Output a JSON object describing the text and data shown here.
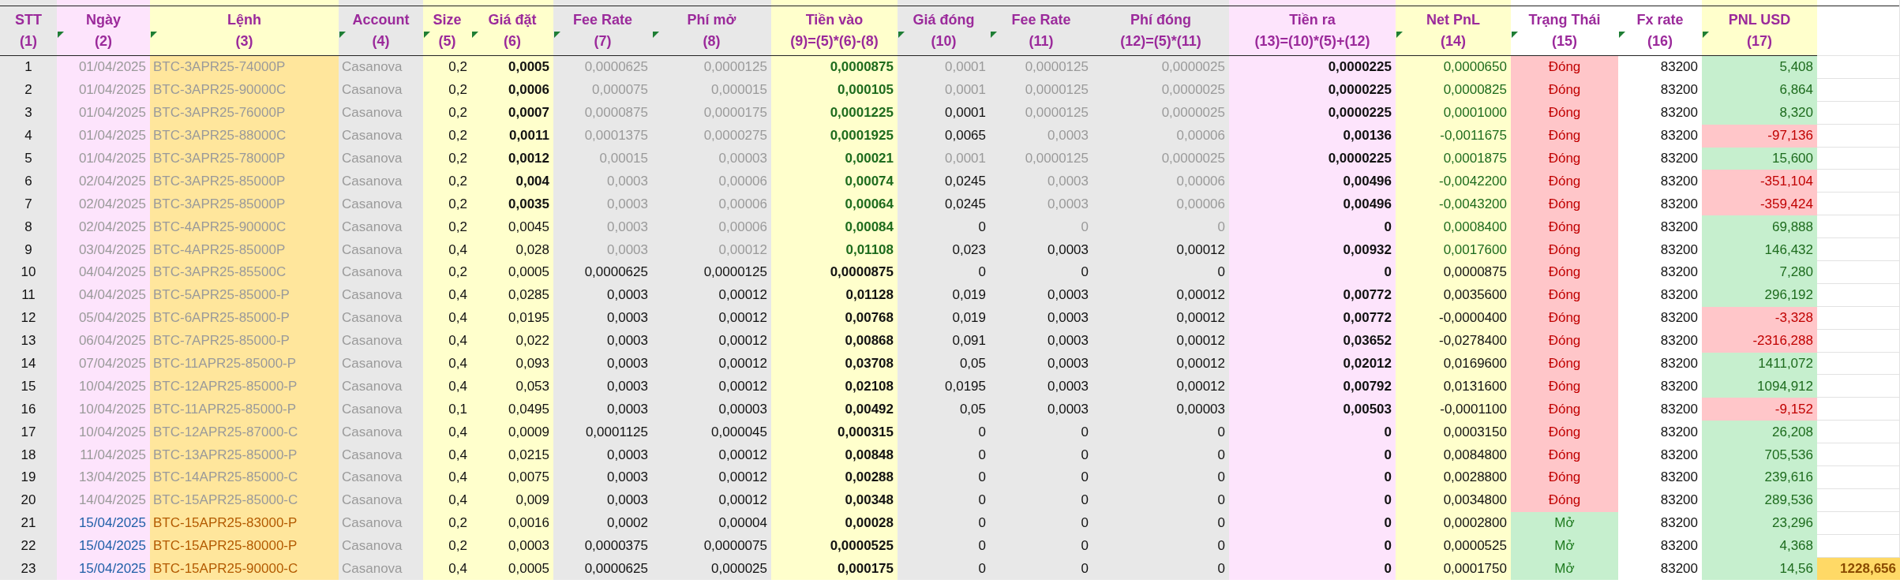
{
  "table": {
    "columns": [
      {
        "label": "STT",
        "number": "(1)",
        "note": false
      },
      {
        "label": "Ngày",
        "number": "(2)",
        "note": true
      },
      {
        "label": "Lệnh",
        "number": "(3)",
        "note": true
      },
      {
        "label": "Account",
        "number": "(4)",
        "note": true
      },
      {
        "label": "Size",
        "number": "(5)",
        "note": true
      },
      {
        "label": "Giá đặt",
        "number": "(6)",
        "note": true
      },
      {
        "label": "Fee Rate",
        "number": "(7)",
        "note": true
      },
      {
        "label": "Phí mở",
        "number": "(8)",
        "note": true
      },
      {
        "label": "Tiền vào",
        "number": "(9)=(5)*(6)-(8)",
        "note": false
      },
      {
        "label": "Giá đóng",
        "number": "(10)",
        "note": true
      },
      {
        "label": "Fee Rate",
        "number": "(11)",
        "note": true
      },
      {
        "label": "Phí đóng",
        "number": "(12)=(5)*(11)",
        "note": false
      },
      {
        "label": "Tiền ra",
        "number": "(13)=(10)*(5)+(12)",
        "note": false
      },
      {
        "label": "Net PnL",
        "number": "(14)",
        "note": true
      },
      {
        "label": "Trạng Thái",
        "number": "(15)",
        "note": true
      },
      {
        "label": "Fx rate",
        "number": "(16)",
        "note": true
      },
      {
        "label": "PNL USD",
        "number": "(17)",
        "note": true
      }
    ],
    "rows": [
      {
        "cells": [
          {
            "text": "1",
            "kind": "plain"
          },
          {
            "text": "01/04/2025",
            "kind": "muted"
          },
          {
            "text": "BTC-3APR25-74000P",
            "kind": "muted"
          },
          {
            "text": "Casanova",
            "kind": "muted"
          },
          {
            "text": "0,2",
            "kind": "plain"
          },
          {
            "text": "0,0005",
            "kind": "bold"
          },
          {
            "text": "0,0000625",
            "kind": "muted"
          },
          {
            "text": "0,0000125",
            "kind": "muted"
          },
          {
            "text": "0,0000875",
            "kind": "greenbold"
          },
          {
            "text": "0,0001",
            "kind": "muted"
          },
          {
            "text": "0,0000125",
            "kind": "muted"
          },
          {
            "text": "0,0000025",
            "kind": "muted"
          },
          {
            "text": "0,0000225",
            "kind": "bold"
          },
          {
            "text": "0,0000650",
            "kind": "green"
          },
          {
            "text": "Đóng",
            "kind": "closed"
          },
          {
            "text": "83200",
            "kind": "plain"
          },
          {
            "text": "5,408",
            "kind": "gain"
          }
        ]
      },
      {
        "cells": [
          {
            "text": "2",
            "kind": "plain"
          },
          {
            "text": "01/04/2025",
            "kind": "muted"
          },
          {
            "text": "BTC-3APR25-90000C",
            "kind": "muted"
          },
          {
            "text": "Casanova",
            "kind": "muted"
          },
          {
            "text": "0,2",
            "kind": "plain"
          },
          {
            "text": "0,0006",
            "kind": "bold"
          },
          {
            "text": "0,000075",
            "kind": "muted"
          },
          {
            "text": "0,000015",
            "kind": "muted"
          },
          {
            "text": "0,000105",
            "kind": "greenbold"
          },
          {
            "text": "0,0001",
            "kind": "muted"
          },
          {
            "text": "0,0000125",
            "kind": "muted"
          },
          {
            "text": "0,0000025",
            "kind": "muted"
          },
          {
            "text": "0,0000225",
            "kind": "bold"
          },
          {
            "text": "0,0000825",
            "kind": "green"
          },
          {
            "text": "Đóng",
            "kind": "closed"
          },
          {
            "text": "83200",
            "kind": "plain"
          },
          {
            "text": "6,864",
            "kind": "gain"
          }
        ]
      },
      {
        "cells": [
          {
            "text": "3",
            "kind": "plain"
          },
          {
            "text": "01/04/2025",
            "kind": "muted"
          },
          {
            "text": "BTC-3APR25-76000P",
            "kind": "muted"
          },
          {
            "text": "Casanova",
            "kind": "muted"
          },
          {
            "text": "0,2",
            "kind": "plain"
          },
          {
            "text": "0,0007",
            "kind": "bold"
          },
          {
            "text": "0,0000875",
            "kind": "muted"
          },
          {
            "text": "0,0000175",
            "kind": "muted"
          },
          {
            "text": "0,0001225",
            "kind": "greenbold"
          },
          {
            "text": "0,0001",
            "kind": "plain"
          },
          {
            "text": "0,0000125",
            "kind": "muted"
          },
          {
            "text": "0,0000025",
            "kind": "muted"
          },
          {
            "text": "0,0000225",
            "kind": "bold"
          },
          {
            "text": "0,0001000",
            "kind": "green"
          },
          {
            "text": "Đóng",
            "kind": "closed"
          },
          {
            "text": "83200",
            "kind": "plain"
          },
          {
            "text": "8,320",
            "kind": "gain"
          }
        ]
      },
      {
        "cells": [
          {
            "text": "4",
            "kind": "plain"
          },
          {
            "text": "01/04/2025",
            "kind": "muted"
          },
          {
            "text": "BTC-3APR25-88000C",
            "kind": "muted"
          },
          {
            "text": "Casanova",
            "kind": "muted"
          },
          {
            "text": "0,2",
            "kind": "plain"
          },
          {
            "text": "0,0011",
            "kind": "bold"
          },
          {
            "text": "0,0001375",
            "kind": "muted"
          },
          {
            "text": "0,0000275",
            "kind": "muted"
          },
          {
            "text": "0,0001925",
            "kind": "greenbold"
          },
          {
            "text": "0,0065",
            "kind": "plain"
          },
          {
            "text": "0,0003",
            "kind": "muted"
          },
          {
            "text": "0,00006",
            "kind": "muted"
          },
          {
            "text": "0,00136",
            "kind": "bold"
          },
          {
            "text": "-0,0011675",
            "kind": "green"
          },
          {
            "text": "Đóng",
            "kind": "closed"
          },
          {
            "text": "83200",
            "kind": "plain"
          },
          {
            "text": "-97,136",
            "kind": "loss"
          }
        ]
      },
      {
        "cells": [
          {
            "text": "5",
            "kind": "plain"
          },
          {
            "text": "01/04/2025",
            "kind": "muted"
          },
          {
            "text": "BTC-3APR25-78000P",
            "kind": "muted"
          },
          {
            "text": "Casanova",
            "kind": "muted"
          },
          {
            "text": "0,2",
            "kind": "plain"
          },
          {
            "text": "0,0012",
            "kind": "bold"
          },
          {
            "text": "0,00015",
            "kind": "muted"
          },
          {
            "text": "0,00003",
            "kind": "muted"
          },
          {
            "text": "0,00021",
            "kind": "greenbold"
          },
          {
            "text": "0,0001",
            "kind": "muted"
          },
          {
            "text": "0,0000125",
            "kind": "muted"
          },
          {
            "text": "0,0000025",
            "kind": "muted"
          },
          {
            "text": "0,0000225",
            "kind": "bold"
          },
          {
            "text": "0,0001875",
            "kind": "green"
          },
          {
            "text": "Đóng",
            "kind": "closed"
          },
          {
            "text": "83200",
            "kind": "plain"
          },
          {
            "text": "15,600",
            "kind": "gain"
          }
        ]
      },
      {
        "cells": [
          {
            "text": "6",
            "kind": "plain"
          },
          {
            "text": "02/04/2025",
            "kind": "muted"
          },
          {
            "text": "BTC-3APR25-85000P",
            "kind": "muted"
          },
          {
            "text": "Casanova",
            "kind": "muted"
          },
          {
            "text": "0,2",
            "kind": "plain"
          },
          {
            "text": "0,004",
            "kind": "bold"
          },
          {
            "text": "0,0003",
            "kind": "muted"
          },
          {
            "text": "0,00006",
            "kind": "muted"
          },
          {
            "text": "0,00074",
            "kind": "greenbold"
          },
          {
            "text": "0,0245",
            "kind": "plain"
          },
          {
            "text": "0,0003",
            "kind": "muted"
          },
          {
            "text": "0,00006",
            "kind": "muted"
          },
          {
            "text": "0,00496",
            "kind": "bold"
          },
          {
            "text": "-0,0042200",
            "kind": "green"
          },
          {
            "text": "Đóng",
            "kind": "closed"
          },
          {
            "text": "83200",
            "kind": "plain"
          },
          {
            "text": "-351,104",
            "kind": "loss"
          }
        ]
      },
      {
        "cells": [
          {
            "text": "7",
            "kind": "plain"
          },
          {
            "text": "02/04/2025",
            "kind": "muted"
          },
          {
            "text": "BTC-3APR25-85000P",
            "kind": "muted"
          },
          {
            "text": "Casanova",
            "kind": "muted"
          },
          {
            "text": "0,2",
            "kind": "plain"
          },
          {
            "text": "0,0035",
            "kind": "bold"
          },
          {
            "text": "0,0003",
            "kind": "muted"
          },
          {
            "text": "0,00006",
            "kind": "muted"
          },
          {
            "text": "0,00064",
            "kind": "greenbold"
          },
          {
            "text": "0,0245",
            "kind": "plain"
          },
          {
            "text": "0,0003",
            "kind": "muted"
          },
          {
            "text": "0,00006",
            "kind": "muted"
          },
          {
            "text": "0,00496",
            "kind": "bold"
          },
          {
            "text": "-0,0043200",
            "kind": "green"
          },
          {
            "text": "Đóng",
            "kind": "closed"
          },
          {
            "text": "83200",
            "kind": "plain"
          },
          {
            "text": "-359,424",
            "kind": "loss"
          }
        ]
      },
      {
        "cells": [
          {
            "text": "8",
            "kind": "plain"
          },
          {
            "text": "02/04/2025",
            "kind": "muted"
          },
          {
            "text": "BTC-4APR25-90000C",
            "kind": "muted"
          },
          {
            "text": "Casanova",
            "kind": "muted"
          },
          {
            "text": "0,2",
            "kind": "plain"
          },
          {
            "text": "0,0045",
            "kind": "plain"
          },
          {
            "text": "0,0003",
            "kind": "muted"
          },
          {
            "text": "0,00006",
            "kind": "muted"
          },
          {
            "text": "0,00084",
            "kind": "greenbold"
          },
          {
            "text": "0",
            "kind": "plain"
          },
          {
            "text": "0",
            "kind": "muted"
          },
          {
            "text": "0",
            "kind": "muted"
          },
          {
            "text": "0",
            "kind": "bold"
          },
          {
            "text": "0,0008400",
            "kind": "green"
          },
          {
            "text": "Đóng",
            "kind": "closed"
          },
          {
            "text": "83200",
            "kind": "plain"
          },
          {
            "text": "69,888",
            "kind": "gain"
          }
        ]
      },
      {
        "cells": [
          {
            "text": "9",
            "kind": "plain"
          },
          {
            "text": "03/04/2025",
            "kind": "muted"
          },
          {
            "text": "BTC-4APR25-85000P",
            "kind": "muted"
          },
          {
            "text": "Casanova",
            "kind": "muted"
          },
          {
            "text": "0,4",
            "kind": "plain"
          },
          {
            "text": "0,028",
            "kind": "plain"
          },
          {
            "text": "0,0003",
            "kind": "muted"
          },
          {
            "text": "0,00012",
            "kind": "muted"
          },
          {
            "text": "0,01108",
            "kind": "greenbold"
          },
          {
            "text": "0,023",
            "kind": "plain"
          },
          {
            "text": "0,0003",
            "kind": "plain"
          },
          {
            "text": "0,00012",
            "kind": "plain"
          },
          {
            "text": "0,00932",
            "kind": "bold"
          },
          {
            "text": "0,0017600",
            "kind": "green"
          },
          {
            "text": "Đóng",
            "kind": "closed"
          },
          {
            "text": "83200",
            "kind": "plain"
          },
          {
            "text": "146,432",
            "kind": "gain"
          }
        ]
      },
      {
        "cells": [
          {
            "text": "10",
            "kind": "plain"
          },
          {
            "text": "04/04/2025",
            "kind": "muted"
          },
          {
            "text": "BTC-3APR25-85500C",
            "kind": "muted"
          },
          {
            "text": "Casanova",
            "kind": "muted"
          },
          {
            "text": "0,2",
            "kind": "plain"
          },
          {
            "text": "0,0005",
            "kind": "plain"
          },
          {
            "text": "0,0000625",
            "kind": "plain"
          },
          {
            "text": "0,0000125",
            "kind": "plain"
          },
          {
            "text": "0,0000875",
            "kind": "bold"
          },
          {
            "text": "0",
            "kind": "plain"
          },
          {
            "text": "0",
            "kind": "plain"
          },
          {
            "text": "0",
            "kind": "plain"
          },
          {
            "text": "0",
            "kind": "bold"
          },
          {
            "text": "0,0000875",
            "kind": "plain"
          },
          {
            "text": "Đóng",
            "kind": "closed"
          },
          {
            "text": "83200",
            "kind": "plain"
          },
          {
            "text": "7,280",
            "kind": "gain"
          }
        ]
      },
      {
        "cells": [
          {
            "text": "11",
            "kind": "plain"
          },
          {
            "text": "04/04/2025",
            "kind": "muted"
          },
          {
            "text": "BTC-5APR25-85000-P",
            "kind": "muted"
          },
          {
            "text": "Casanova",
            "kind": "muted"
          },
          {
            "text": "0,4",
            "kind": "plain"
          },
          {
            "text": "0,0285",
            "kind": "plain"
          },
          {
            "text": "0,0003",
            "kind": "plain"
          },
          {
            "text": "0,00012",
            "kind": "plain"
          },
          {
            "text": "0,01128",
            "kind": "bold"
          },
          {
            "text": "0,019",
            "kind": "plain"
          },
          {
            "text": "0,0003",
            "kind": "plain"
          },
          {
            "text": "0,00012",
            "kind": "plain"
          },
          {
            "text": "0,00772",
            "kind": "bold"
          },
          {
            "text": "0,0035600",
            "kind": "plain"
          },
          {
            "text": "Đóng",
            "kind": "closed"
          },
          {
            "text": "83200",
            "kind": "plain"
          },
          {
            "text": "296,192",
            "kind": "gain"
          }
        ]
      },
      {
        "cells": [
          {
            "text": "12",
            "kind": "plain"
          },
          {
            "text": "05/04/2025",
            "kind": "muted"
          },
          {
            "text": "BTC-6APR25-85000-P",
            "kind": "muted"
          },
          {
            "text": "Casanova",
            "kind": "muted"
          },
          {
            "text": "0,4",
            "kind": "plain"
          },
          {
            "text": "0,0195",
            "kind": "plain"
          },
          {
            "text": "0,0003",
            "kind": "plain"
          },
          {
            "text": "0,00012",
            "kind": "plain"
          },
          {
            "text": "0,00768",
            "kind": "bold"
          },
          {
            "text": "0,019",
            "kind": "plain"
          },
          {
            "text": "0,0003",
            "kind": "plain"
          },
          {
            "text": "0,00012",
            "kind": "plain"
          },
          {
            "text": "0,00772",
            "kind": "bold"
          },
          {
            "text": "-0,0000400",
            "kind": "plain"
          },
          {
            "text": "Đóng",
            "kind": "closed"
          },
          {
            "text": "83200",
            "kind": "plain"
          },
          {
            "text": "-3,328",
            "kind": "loss"
          }
        ]
      },
      {
        "cells": [
          {
            "text": "13",
            "kind": "plain"
          },
          {
            "text": "06/04/2025",
            "kind": "muted"
          },
          {
            "text": "BTC-7APR25-85000-P",
            "kind": "muted"
          },
          {
            "text": "Casanova",
            "kind": "muted"
          },
          {
            "text": "0,4",
            "kind": "plain"
          },
          {
            "text": "0,022",
            "kind": "plain"
          },
          {
            "text": "0,0003",
            "kind": "plain"
          },
          {
            "text": "0,00012",
            "kind": "plain"
          },
          {
            "text": "0,00868",
            "kind": "bold"
          },
          {
            "text": "0,091",
            "kind": "plain"
          },
          {
            "text": "0,0003",
            "kind": "plain"
          },
          {
            "text": "0,00012",
            "kind": "plain"
          },
          {
            "text": "0,03652",
            "kind": "bold"
          },
          {
            "text": "-0,0278400",
            "kind": "plain"
          },
          {
            "text": "Đóng",
            "kind": "closed"
          },
          {
            "text": "83200",
            "kind": "plain"
          },
          {
            "text": "-2316,288",
            "kind": "loss"
          }
        ]
      },
      {
        "cells": [
          {
            "text": "14",
            "kind": "plain"
          },
          {
            "text": "07/04/2025",
            "kind": "muted"
          },
          {
            "text": "BTC-11APR25-85000-P",
            "kind": "muted"
          },
          {
            "text": "Casanova",
            "kind": "muted"
          },
          {
            "text": "0,4",
            "kind": "plain"
          },
          {
            "text": "0,093",
            "kind": "plain"
          },
          {
            "text": "0,0003",
            "kind": "plain"
          },
          {
            "text": "0,00012",
            "kind": "plain"
          },
          {
            "text": "0,03708",
            "kind": "bold"
          },
          {
            "text": "0,05",
            "kind": "plain"
          },
          {
            "text": "0,0003",
            "kind": "plain"
          },
          {
            "text": "0,00012",
            "kind": "plain"
          },
          {
            "text": "0,02012",
            "kind": "bold"
          },
          {
            "text": "0,0169600",
            "kind": "plain"
          },
          {
            "text": "Đóng",
            "kind": "closed"
          },
          {
            "text": "83200",
            "kind": "plain"
          },
          {
            "text": "1411,072",
            "kind": "gain"
          }
        ]
      },
      {
        "cells": [
          {
            "text": "15",
            "kind": "plain"
          },
          {
            "text": "10/04/2025",
            "kind": "muted"
          },
          {
            "text": "BTC-12APR25-85000-P",
            "kind": "muted"
          },
          {
            "text": "Casanova",
            "kind": "muted"
          },
          {
            "text": "0,4",
            "kind": "plain"
          },
          {
            "text": "0,053",
            "kind": "plain"
          },
          {
            "text": "0,0003",
            "kind": "plain"
          },
          {
            "text": "0,00012",
            "kind": "plain"
          },
          {
            "text": "0,02108",
            "kind": "bold"
          },
          {
            "text": "0,0195",
            "kind": "plain"
          },
          {
            "text": "0,0003",
            "kind": "plain"
          },
          {
            "text": "0,00012",
            "kind": "plain"
          },
          {
            "text": "0,00792",
            "kind": "bold"
          },
          {
            "text": "0,0131600",
            "kind": "plain"
          },
          {
            "text": "Đóng",
            "kind": "closed"
          },
          {
            "text": "83200",
            "kind": "plain"
          },
          {
            "text": "1094,912",
            "kind": "gain"
          }
        ]
      },
      {
        "cells": [
          {
            "text": "16",
            "kind": "plain"
          },
          {
            "text": "10/04/2025",
            "kind": "muted"
          },
          {
            "text": "BTC-11APR25-85000-P",
            "kind": "muted"
          },
          {
            "text": "Casanova",
            "kind": "muted"
          },
          {
            "text": "0,1",
            "kind": "plain"
          },
          {
            "text": "0,0495",
            "kind": "plain"
          },
          {
            "text": "0,0003",
            "kind": "plain"
          },
          {
            "text": "0,00003",
            "kind": "plain"
          },
          {
            "text": "0,00492",
            "kind": "bold"
          },
          {
            "text": "0,05",
            "kind": "plain"
          },
          {
            "text": "0,0003",
            "kind": "plain"
          },
          {
            "text": "0,00003",
            "kind": "plain"
          },
          {
            "text": "0,00503",
            "kind": "bold"
          },
          {
            "text": "-0,0001100",
            "kind": "plain"
          },
          {
            "text": "Đóng",
            "kind": "closed"
          },
          {
            "text": "83200",
            "kind": "plain"
          },
          {
            "text": "-9,152",
            "kind": "loss"
          }
        ]
      },
      {
        "cells": [
          {
            "text": "17",
            "kind": "plain"
          },
          {
            "text": "10/04/2025",
            "kind": "muted"
          },
          {
            "text": "BTC-12APR25-87000-C",
            "kind": "muted"
          },
          {
            "text": "Casanova",
            "kind": "muted"
          },
          {
            "text": "0,4",
            "kind": "plain"
          },
          {
            "text": "0,0009",
            "kind": "plain"
          },
          {
            "text": "0,0001125",
            "kind": "plain"
          },
          {
            "text": "0,000045",
            "kind": "plain"
          },
          {
            "text": "0,000315",
            "kind": "bold"
          },
          {
            "text": "0",
            "kind": "plain"
          },
          {
            "text": "0",
            "kind": "plain"
          },
          {
            "text": "0",
            "kind": "plain"
          },
          {
            "text": "0",
            "kind": "bold"
          },
          {
            "text": "0,0003150",
            "kind": "plain"
          },
          {
            "text": "Đóng",
            "kind": "closed"
          },
          {
            "text": "83200",
            "kind": "plain"
          },
          {
            "text": "26,208",
            "kind": "gain"
          }
        ]
      },
      {
        "cells": [
          {
            "text": "18",
            "kind": "plain"
          },
          {
            "text": "11/04/2025",
            "kind": "muted"
          },
          {
            "text": "BTC-13APR25-85000-P",
            "kind": "muted"
          },
          {
            "text": "Casanova",
            "kind": "muted"
          },
          {
            "text": "0,4",
            "kind": "plain"
          },
          {
            "text": "0,0215",
            "kind": "plain"
          },
          {
            "text": "0,0003",
            "kind": "plain"
          },
          {
            "text": "0,00012",
            "kind": "plain"
          },
          {
            "text": "0,00848",
            "kind": "bold"
          },
          {
            "text": "0",
            "kind": "plain"
          },
          {
            "text": "0",
            "kind": "plain"
          },
          {
            "text": "0",
            "kind": "plain"
          },
          {
            "text": "0",
            "kind": "bold"
          },
          {
            "text": "0,0084800",
            "kind": "plain"
          },
          {
            "text": "Đóng",
            "kind": "closed"
          },
          {
            "text": "83200",
            "kind": "plain"
          },
          {
            "text": "705,536",
            "kind": "gain"
          }
        ]
      },
      {
        "cells": [
          {
            "text": "19",
            "kind": "plain"
          },
          {
            "text": "13/04/2025",
            "kind": "muted"
          },
          {
            "text": "BTC-14APR25-85000-C",
            "kind": "muted"
          },
          {
            "text": "Casanova",
            "kind": "muted"
          },
          {
            "text": "0,4",
            "kind": "plain"
          },
          {
            "text": "0,0075",
            "kind": "plain"
          },
          {
            "text": "0,0003",
            "kind": "plain"
          },
          {
            "text": "0,00012",
            "kind": "plain"
          },
          {
            "text": "0,00288",
            "kind": "bold"
          },
          {
            "text": "0",
            "kind": "plain"
          },
          {
            "text": "0",
            "kind": "plain"
          },
          {
            "text": "0",
            "kind": "plain"
          },
          {
            "text": "0",
            "kind": "bold"
          },
          {
            "text": "0,0028800",
            "kind": "plain"
          },
          {
            "text": "Đóng",
            "kind": "closed"
          },
          {
            "text": "83200",
            "kind": "plain"
          },
          {
            "text": "239,616",
            "kind": "gain"
          }
        ]
      },
      {
        "cells": [
          {
            "text": "20",
            "kind": "plain"
          },
          {
            "text": "14/04/2025",
            "kind": "muted"
          },
          {
            "text": "BTC-15APR25-85000-C",
            "kind": "muted"
          },
          {
            "text": "Casanova",
            "kind": "muted"
          },
          {
            "text": "0,4",
            "kind": "plain"
          },
          {
            "text": "0,009",
            "kind": "plain"
          },
          {
            "text": "0,0003",
            "kind": "plain"
          },
          {
            "text": "0,00012",
            "kind": "plain"
          },
          {
            "text": "0,00348",
            "kind": "bold"
          },
          {
            "text": "0",
            "kind": "plain"
          },
          {
            "text": "0",
            "kind": "plain"
          },
          {
            "text": "0",
            "kind": "plain"
          },
          {
            "text": "0",
            "kind": "bold"
          },
          {
            "text": "0,0034800",
            "kind": "plain"
          },
          {
            "text": "Đóng",
            "kind": "closed"
          },
          {
            "text": "83200",
            "kind": "plain"
          },
          {
            "text": "289,536",
            "kind": "gain"
          }
        ]
      },
      {
        "cells": [
          {
            "text": "21",
            "kind": "plain"
          },
          {
            "text": "15/04/2025",
            "kind": "blue"
          },
          {
            "text": "BTC-15APR25-83000-P",
            "kind": "brown"
          },
          {
            "text": "Casanova",
            "kind": "muted"
          },
          {
            "text": "0,2",
            "kind": "plain"
          },
          {
            "text": "0,0016",
            "kind": "plain"
          },
          {
            "text": "0,0002",
            "kind": "plain"
          },
          {
            "text": "0,00004",
            "kind": "plain"
          },
          {
            "text": "0,00028",
            "kind": "bold"
          },
          {
            "text": "0",
            "kind": "plain"
          },
          {
            "text": "0",
            "kind": "plain"
          },
          {
            "text": "0",
            "kind": "plain"
          },
          {
            "text": "0",
            "kind": "bold"
          },
          {
            "text": "0,0002800",
            "kind": "plain"
          },
          {
            "text": "Mở",
            "kind": "open"
          },
          {
            "text": "83200",
            "kind": "plain"
          },
          {
            "text": "23,296",
            "kind": "gain"
          }
        ]
      },
      {
        "cells": [
          {
            "text": "22",
            "kind": "plain"
          },
          {
            "text": "15/04/2025",
            "kind": "blue"
          },
          {
            "text": "BTC-15APR25-80000-P",
            "kind": "brown"
          },
          {
            "text": "Casanova",
            "kind": "muted"
          },
          {
            "text": "0,2",
            "kind": "plain"
          },
          {
            "text": "0,0003",
            "kind": "plain"
          },
          {
            "text": "0,0000375",
            "kind": "plain"
          },
          {
            "text": "0,0000075",
            "kind": "plain"
          },
          {
            "text": "0,0000525",
            "kind": "bold"
          },
          {
            "text": "0",
            "kind": "plain"
          },
          {
            "text": "0",
            "kind": "plain"
          },
          {
            "text": "0",
            "kind": "plain"
          },
          {
            "text": "0",
            "kind": "bold"
          },
          {
            "text": "0,0000525",
            "kind": "plain"
          },
          {
            "text": "Mở",
            "kind": "open"
          },
          {
            "text": "83200",
            "kind": "plain"
          },
          {
            "text": "4,368",
            "kind": "gain"
          }
        ]
      },
      {
        "cells": [
          {
            "text": "23",
            "kind": "plain"
          },
          {
            "text": "15/04/2025",
            "kind": "blue"
          },
          {
            "text": "BTC-15APR25-90000-C",
            "kind": "brown"
          },
          {
            "text": "Casanova",
            "kind": "muted"
          },
          {
            "text": "0,4",
            "kind": "plain"
          },
          {
            "text": "0,0005",
            "kind": "plain"
          },
          {
            "text": "0,0000625",
            "kind": "plain"
          },
          {
            "text": "0,000025",
            "kind": "plain"
          },
          {
            "text": "0,000175",
            "kind": "bold"
          },
          {
            "text": "0",
            "kind": "plain"
          },
          {
            "text": "0",
            "kind": "plain"
          },
          {
            "text": "0",
            "kind": "plain"
          },
          {
            "text": "0",
            "kind": "bold"
          },
          {
            "text": "0,0001750",
            "kind": "plain"
          },
          {
            "text": "Mở",
            "kind": "open"
          },
          {
            "text": "83200",
            "kind": "plain"
          },
          {
            "text": "14,56",
            "kind": "gain"
          }
        ]
      }
    ],
    "grand_total": "1228,656"
  }
}
